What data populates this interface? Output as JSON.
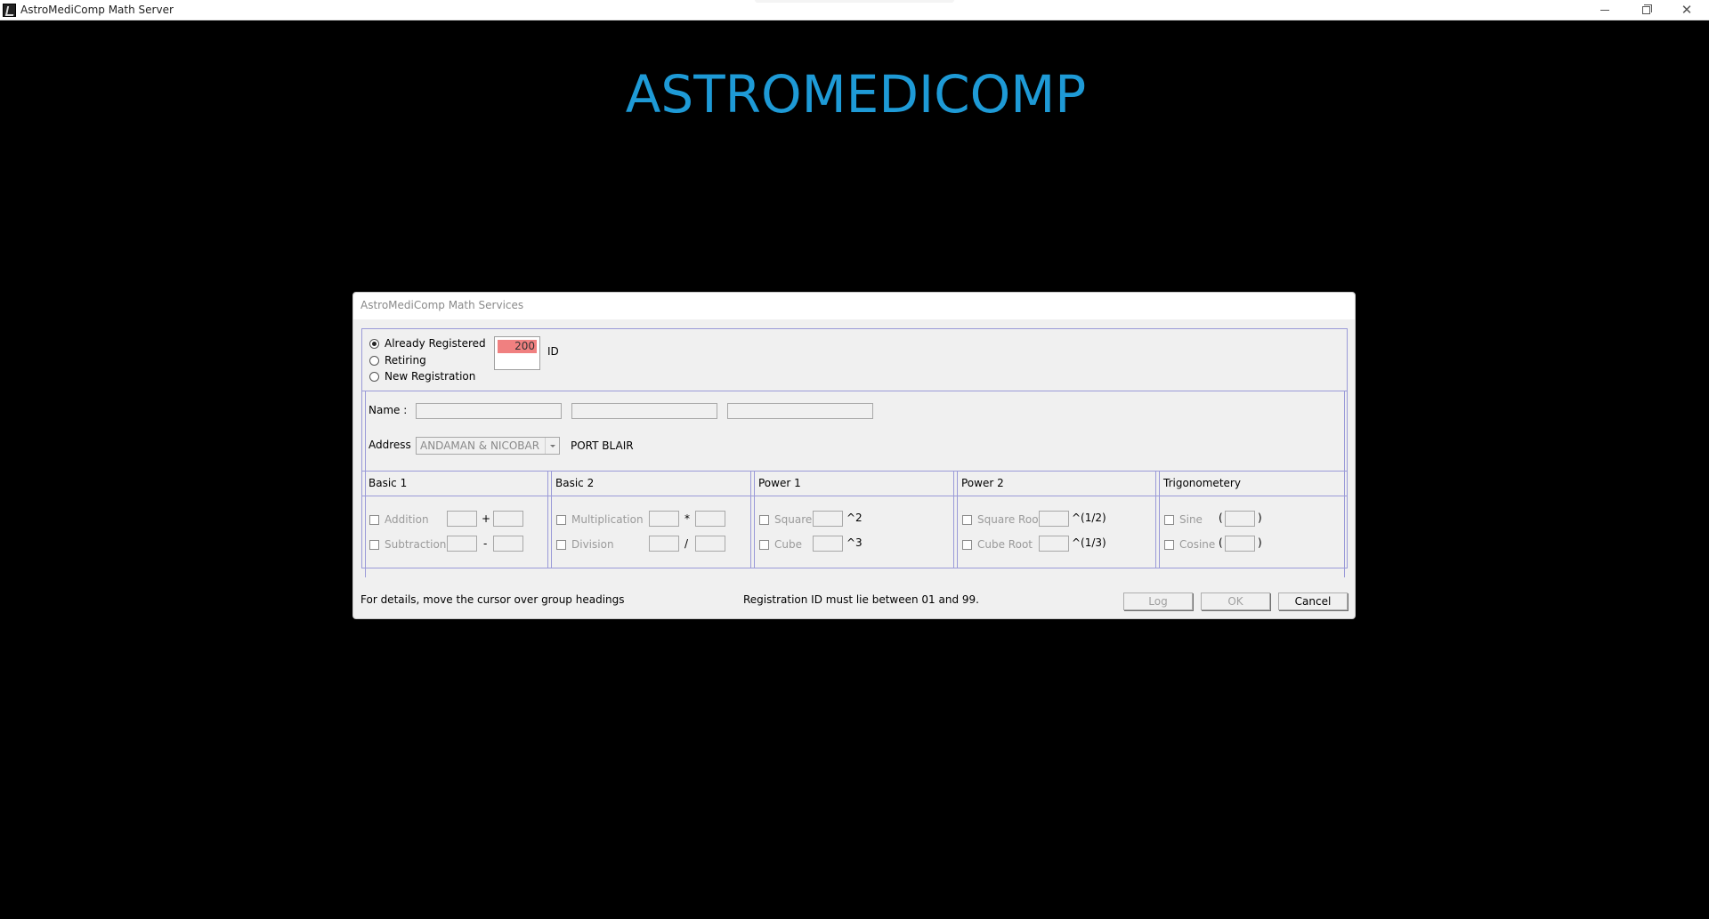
{
  "window": {
    "title": "AstroMediComp Math Server",
    "controls": {
      "minimize": "minimize-icon",
      "maximize": "restore-icon",
      "close": "close-icon"
    }
  },
  "banner": {
    "text": "ASTROMEDICOMP",
    "color": "#1e9ad6"
  },
  "dialog": {
    "title": "AstroMediComp Math Services",
    "registration": {
      "options": [
        "Already Registered",
        "Retiring",
        "New Registration"
      ],
      "selected": "Already Registered",
      "id_value": "200",
      "id_label": "ID",
      "id_highlight_color": "#f08080"
    },
    "name": {
      "label": "Name :",
      "fields": [
        "",
        "",
        ""
      ]
    },
    "address": {
      "label": "Address :",
      "state": "ANDAMAN & NICOBAR",
      "city": "PORT BLAIR"
    },
    "groups": {
      "basic1": {
        "title": "Basic 1",
        "ops": [
          {
            "label": "Addition",
            "symbol": "+"
          },
          {
            "label": "Subtraction",
            "symbol": "-"
          }
        ]
      },
      "basic2": {
        "title": "Basic 2",
        "ops": [
          {
            "label": "Multiplication",
            "symbol": "*"
          },
          {
            "label": "Division",
            "symbol": "/"
          }
        ]
      },
      "power1": {
        "title": "Power 1",
        "ops": [
          {
            "label": "Square",
            "symbol": "^2"
          },
          {
            "label": "Cube",
            "symbol": "^3"
          }
        ]
      },
      "power2": {
        "title": "Power 2",
        "ops": [
          {
            "label": "Square Root",
            "symbol": "^(1/2)"
          },
          {
            "label": "Cube Root",
            "symbol": "^(1/3)"
          }
        ]
      },
      "trig": {
        "title": "Trigonometery",
        "ops": [
          {
            "label": "Sine",
            "open": "(",
            "close": ")"
          },
          {
            "label": "Cosine",
            "open": "(",
            "close": ")"
          }
        ]
      }
    },
    "footer": {
      "hint": "For details, move the cursor over group headings",
      "message": "Registration ID must lie between 01 and 99.",
      "buttons": {
        "log": "Log",
        "ok": "OK",
        "cancel": "Cancel"
      }
    }
  }
}
